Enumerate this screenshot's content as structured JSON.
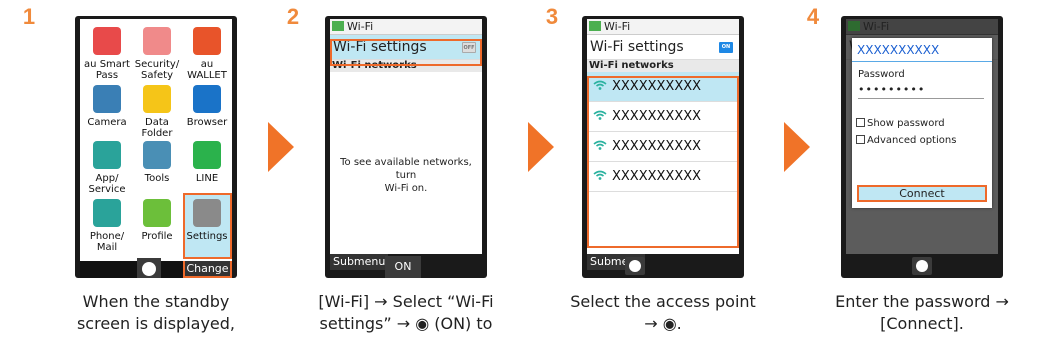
{
  "steps": [
    {
      "num": "1",
      "caption_lines": [
        "When the standby",
        "screen is displayed,"
      ]
    },
    {
      "num": "2",
      "caption_lines": [
        "[Wi-Fi] → Select “Wi-Fi",
        "settings” → ◉ (ON) to"
      ]
    },
    {
      "num": "3",
      "caption_lines": [
        "Select the access point",
        "→ ◉."
      ]
    },
    {
      "num": "4",
      "caption_lines": [
        "Enter the password →",
        "[Connect]."
      ]
    }
  ],
  "apps": [
    {
      "label": "au Smart Pass",
      "line1": "au Smart",
      "line2": "Pass",
      "icon": "pass-icon",
      "color": "#e84a4a"
    },
    {
      "label": "Security/ Safety",
      "line1": "Security/",
      "line2": "Safety",
      "icon": "heart-icon",
      "color": "#f08a8a"
    },
    {
      "label": "au WALLET",
      "line1": "au",
      "line2": "WALLET",
      "icon": "au-wallet-icon",
      "color": "#e8542a"
    },
    {
      "label": "Camera",
      "line1": "Camera",
      "line2": "",
      "icon": "camera-icon",
      "color": "#3a7fb5"
    },
    {
      "label": "Data Folder",
      "line1": "Data",
      "line2": "Folder",
      "icon": "folder-icon",
      "color": "#f5c518"
    },
    {
      "label": "Browser",
      "line1": "Browser",
      "line2": "",
      "icon": "globe-icon",
      "color": "#1a73c8"
    },
    {
      "label": "App/ Service",
      "line1": "App/",
      "line2": "Service",
      "icon": "app-icon",
      "color": "#2aa39a"
    },
    {
      "label": "Tools",
      "line1": "Tools",
      "line2": "",
      "icon": "calculator-icon",
      "color": "#4a8fb5"
    },
    {
      "label": "LINE",
      "line1": "LINE",
      "line2": "",
      "icon": "line-icon",
      "color": "#2bb24c"
    },
    {
      "label": "Phone/ Mail",
      "line1": "Phone/",
      "line2": "Mail",
      "icon": "phone-mail-icon",
      "color": "#2aa39a"
    },
    {
      "label": "Profile",
      "line1": "Profile",
      "line2": "",
      "icon": "profile-icon",
      "color": "#6cbf3a"
    },
    {
      "label": "Settings",
      "line1": "Settings",
      "line2": "",
      "icon": "tools-icon",
      "color": "#8a8a8a"
    }
  ],
  "screen1": {
    "softkey_right": "Change"
  },
  "wifi": {
    "title": "Wi-Fi",
    "settings_label": "Wi-Fi settings",
    "toggle_off": "OFF",
    "toggle_on": "ON",
    "networks_header": "Wi-Fi networks",
    "empty_message_l1": "To see available networks, turn",
    "empty_message_l2": "Wi-Fi on.",
    "softkey_left": "Submenu",
    "softkey_center_on": "ON",
    "networks": [
      "XXXXXXXXXX",
      "XXXXXXXXXX",
      "XXXXXXXXXX",
      "XXXXXXXXXX"
    ]
  },
  "dialog": {
    "ssid": "XXXXXXXXXX",
    "password_label": "Password",
    "password_value": "•••••••••",
    "show_password": "Show password",
    "advanced_options": "Advanced options",
    "connect": "Connect"
  },
  "colors": {
    "accent": "#ee6a2b",
    "step": "#f08a3c",
    "highlight": "#bfe7f3",
    "link": "#1a5fd1"
  }
}
